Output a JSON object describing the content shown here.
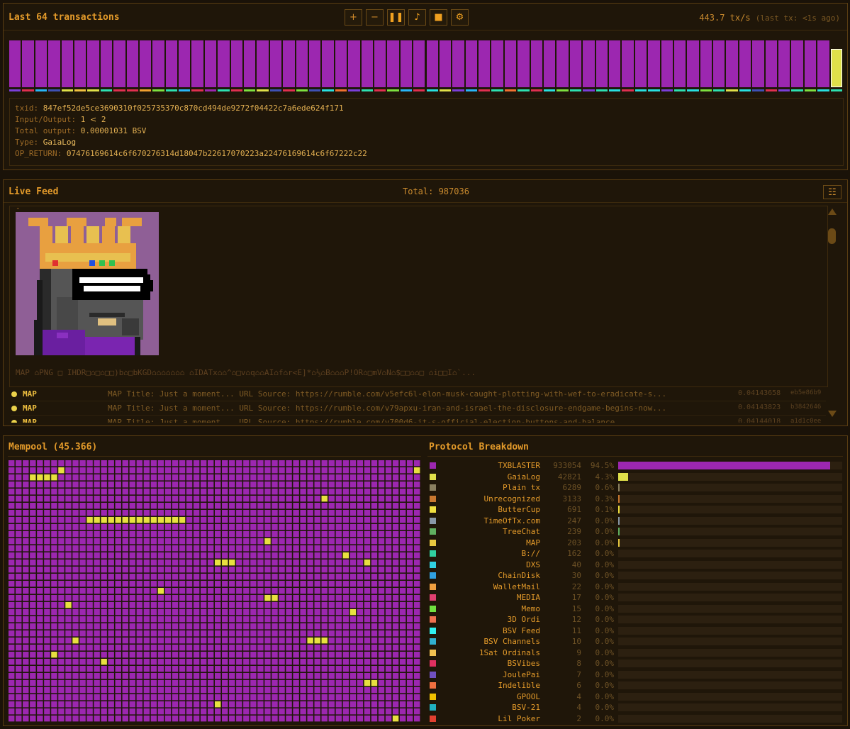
{
  "top": {
    "title": "Last 64 transactions",
    "controls": [
      {
        "name": "zoom-in-button",
        "label": "+"
      },
      {
        "name": "zoom-out-button",
        "label": "−"
      },
      {
        "name": "pause-button",
        "label": "❚❚"
      },
      {
        "name": "sound-button",
        "label": "♪"
      },
      {
        "name": "stop-button",
        "label": "■"
      },
      {
        "name": "settings-button",
        "label": "⚙"
      }
    ],
    "rate": "443.7 tx/s",
    "last_tx": "(last tx: <1s ago)",
    "tx_colors": [
      "#9c27b0",
      "#9c27b0",
      "#9c27b0",
      "#9c27b0",
      "#9c27b0",
      "#9c27b0",
      "#9c27b0",
      "#9c27b0",
      "#9c27b0",
      "#9c27b0",
      "#9c27b0",
      "#9c27b0",
      "#9c27b0",
      "#9c27b0",
      "#9c27b0",
      "#9c27b0",
      "#9c27b0",
      "#9c27b0",
      "#9c27b0",
      "#9c27b0",
      "#9c27b0",
      "#9c27b0",
      "#9c27b0",
      "#9c27b0",
      "#9c27b0",
      "#9c27b0",
      "#9c27b0",
      "#9c27b0",
      "#9c27b0",
      "#9c27b0",
      "#9c27b0",
      "#9c27b0",
      "#9c27b0",
      "#9c27b0",
      "#9c27b0",
      "#9c27b0",
      "#9c27b0",
      "#9c27b0",
      "#9c27b0",
      "#9c27b0",
      "#9c27b0",
      "#9c27b0",
      "#9c27b0",
      "#9c27b0",
      "#9c27b0",
      "#9c27b0",
      "#9c27b0",
      "#9c27b0",
      "#9c27b0",
      "#9c27b0",
      "#9c27b0",
      "#9c27b0",
      "#9c27b0",
      "#9c27b0",
      "#9c27b0",
      "#9c27b0",
      "#9c27b0",
      "#9c27b0",
      "#9c27b0",
      "#9c27b0",
      "#9c27b0",
      "#9c27b0",
      "#9c27b0",
      "#e0e04a"
    ],
    "tick_colors": [
      "#7b3fd8",
      "#e03050",
      "#29b6f6",
      "#3f51b5",
      "#e0e04a",
      "#f0c040",
      "#e0e04a",
      "#2ee0b0",
      "#e03050",
      "#e03050",
      "#f0a030",
      "#7ee040",
      "#2ee0b0",
      "#29b6f6",
      "#e03050",
      "#9c27b0",
      "#2ee0b0",
      "#e03050",
      "#7ee040",
      "#e0e04a",
      "#3f51b5",
      "#e03050",
      "#7ee040",
      "#3f51b5",
      "#29e0e0",
      "#f07030",
      "#7b3fd8",
      "#2ee0b0",
      "#e03050",
      "#7ee040",
      "#29b6f6",
      "#e03050",
      "#29e0e0",
      "#e0e04a",
      "#7b3fd8",
      "#29b6f6",
      "#e03050",
      "#2ee0b0",
      "#f07030",
      "#2ee0b0",
      "#e03050",
      "#29e0e0",
      "#7ee040",
      "#2ee0b0",
      "#7b3fd8",
      "#2ee0b0",
      "#29e0e0",
      "#e03050",
      "#29e0e0",
      "#29e0e0",
      "#7b3fd8",
      "#2ee0b0",
      "#29e0e0",
      "#7ee040",
      "#2ee0b0",
      "#e0e04a",
      "#29e0e0",
      "#3f51b5",
      "#e03050",
      "#7b3fd8",
      "#2ee0b0",
      "#7ee040",
      "#29e0e0",
      "#2ee0b0"
    ],
    "tx": {
      "txid_label": "txid:",
      "txid": "847ef52de5ce3690310f025735370c870cd494de9272f04422c7a6ede624f171",
      "io_label": "Input/Output:",
      "io_in": "1",
      "io_out": "2",
      "total_label": "Total output:",
      "total": "0.00001031 BSV",
      "type_label": "Type:",
      "type": "GaiaLog",
      "op_label": "OP_RETURN:",
      "op_return": "07476169614c6f670276314d18047b22617070223a22476169614c6f67222c22"
    }
  },
  "feed": {
    "title": "Live Feed",
    "total": "Total: 987036",
    "dash": "-",
    "raw_line": "MAP ⌂PNG □ IHDR□⌂□⌂□□)b⌂□bKGD⌂⌂⌂⌂⌂⌂⌂ ⌂IDATx⌂⌂^⌂□v⌂q⌂⌂AI⌂f⌂r<E]*⌂⅓⌂B⌂⌂⌂P!OR⌂□mV⌂N⌂$□□⌂⌂□ ⌂i□□I⌂`...",
    "rows": [
      {
        "proto": "MAP",
        "content": "MAP Title: Just a moment... URL Source: https://rumble.com/v5efc6l-elon-musk-caught-plotting-with-wef-to-eradicate-s...",
        "amount": "0.04143658",
        "txid": "eb5e86b9"
      },
      {
        "proto": "MAP",
        "content": "MAP Title: Just a moment... URL Source: https://rumble.com/v79apxu-iran-and-israel-the-disclosure-endgame-begins-now...",
        "amount": "0.04143823",
        "txid": "b3842646"
      },
      {
        "proto": "MAP",
        "content": "MAP Title: Just a moment... URL Source: https://rumble.com/v700d6-it-s-official-election-buttons-and-balance...",
        "amount": "0.04144018",
        "txid": "a1d1c0ee"
      }
    ]
  },
  "mempool": {
    "title": "Mempool (45.366)",
    "cols": 58,
    "rows": 37,
    "base_color": "#9c27b0",
    "highlight_color": "#e8e040",
    "highlights": [
      [
        1,
        7
      ],
      [
        2,
        3
      ],
      [
        2,
        4
      ],
      [
        2,
        5
      ],
      [
        2,
        6
      ],
      [
        1,
        57
      ],
      [
        5,
        44
      ],
      [
        8,
        11
      ],
      [
        8,
        12
      ],
      [
        8,
        13
      ],
      [
        8,
        14
      ],
      [
        8,
        15
      ],
      [
        8,
        16
      ],
      [
        8,
        17
      ],
      [
        8,
        18
      ],
      [
        8,
        19
      ],
      [
        8,
        20
      ],
      [
        8,
        21
      ],
      [
        8,
        22
      ],
      [
        8,
        23
      ],
      [
        8,
        24
      ],
      [
        11,
        36
      ],
      [
        13,
        47
      ],
      [
        14,
        29
      ],
      [
        14,
        30
      ],
      [
        14,
        31
      ],
      [
        14,
        50
      ],
      [
        18,
        21
      ],
      [
        19,
        36
      ],
      [
        19,
        37
      ],
      [
        20,
        8
      ],
      [
        21,
        48
      ],
      [
        25,
        9
      ],
      [
        25,
        42
      ],
      [
        25,
        43
      ],
      [
        25,
        44
      ],
      [
        27,
        6
      ],
      [
        28,
        13
      ],
      [
        31,
        50
      ],
      [
        31,
        51
      ],
      [
        34,
        29
      ],
      [
        36,
        54
      ]
    ]
  },
  "protocols": {
    "title": "Protocol Breakdown",
    "items": [
      {
        "name": "TXBLASTER",
        "count": "933054",
        "pct": "94.5%",
        "frac": 0.945,
        "color": "#9c27b0"
      },
      {
        "name": "GaiaLog",
        "count": "42821",
        "pct": "4.3%",
        "frac": 0.043,
        "color": "#e0e04a"
      },
      {
        "name": "Plain tx",
        "count": "6289",
        "pct": "0.6%",
        "frac": 0.006,
        "color": "#8a8060"
      },
      {
        "name": "Unrecognized",
        "count": "3133",
        "pct": "0.3%",
        "frac": 0.003,
        "color": "#c87830"
      },
      {
        "name": "ButterCup",
        "count": "691",
        "pct": "0.1%",
        "frac": 0.001,
        "color": "#f0e040"
      },
      {
        "name": "TimeOfTx.com",
        "count": "247",
        "pct": "0.0%",
        "frac": 0.0003,
        "color": "#8898a8"
      },
      {
        "name": "TreeChat",
        "count": "239",
        "pct": "0.0%",
        "frac": 0.0003,
        "color": "#60b060"
      },
      {
        "name": "MAP",
        "count": "203",
        "pct": "0.0%",
        "frac": 0.0002,
        "color": "#e8c840"
      },
      {
        "name": "B://",
        "count": "162",
        "pct": "0.0%",
        "frac": 0,
        "color": "#30d0a0"
      },
      {
        "name": "DXS",
        "count": "40",
        "pct": "0.0%",
        "frac": 0,
        "color": "#30d0e0"
      },
      {
        "name": "ChainDisk",
        "count": "30",
        "pct": "0.0%",
        "frac": 0,
        "color": "#30a0e0"
      },
      {
        "name": "WalletMail",
        "count": "22",
        "pct": "0.0%",
        "frac": 0,
        "color": "#f0a040"
      },
      {
        "name": "MEDIA",
        "count": "17",
        "pct": "0.0%",
        "frac": 0,
        "color": "#e04070"
      },
      {
        "name": "Memo",
        "count": "15",
        "pct": "0.0%",
        "frac": 0,
        "color": "#70e040"
      },
      {
        "name": "3D Ordi",
        "count": "12",
        "pct": "0.0%",
        "frac": 0,
        "color": "#f07050"
      },
      {
        "name": "BSV Feed",
        "count": "11",
        "pct": "0.0%",
        "frac": 0,
        "color": "#30f0f0"
      },
      {
        "name": "BSV Channels",
        "count": "10",
        "pct": "0.0%",
        "frac": 0,
        "color": "#30b0d0"
      },
      {
        "name": "1Sat Ordinals",
        "count": "9",
        "pct": "0.0%",
        "frac": 0,
        "color": "#f0c050"
      },
      {
        "name": "BSVibes",
        "count": "8",
        "pct": "0.0%",
        "frac": 0,
        "color": "#e03060"
      },
      {
        "name": "JoulePai",
        "count": "7",
        "pct": "0.0%",
        "frac": 0,
        "color": "#7050c0"
      },
      {
        "name": "Indelible",
        "count": "6",
        "pct": "0.0%",
        "frac": 0,
        "color": "#f07040"
      },
      {
        "name": "GPOOL",
        "count": "4",
        "pct": "0.0%",
        "frac": 0,
        "color": "#f0c000"
      },
      {
        "name": "BSV-21",
        "count": "4",
        "pct": "0.0%",
        "frac": 0,
        "color": "#20b0c0"
      },
      {
        "name": "Lil Poker",
        "count": "2",
        "pct": "0.0%",
        "frac": 0,
        "color": "#e04030"
      }
    ]
  }
}
